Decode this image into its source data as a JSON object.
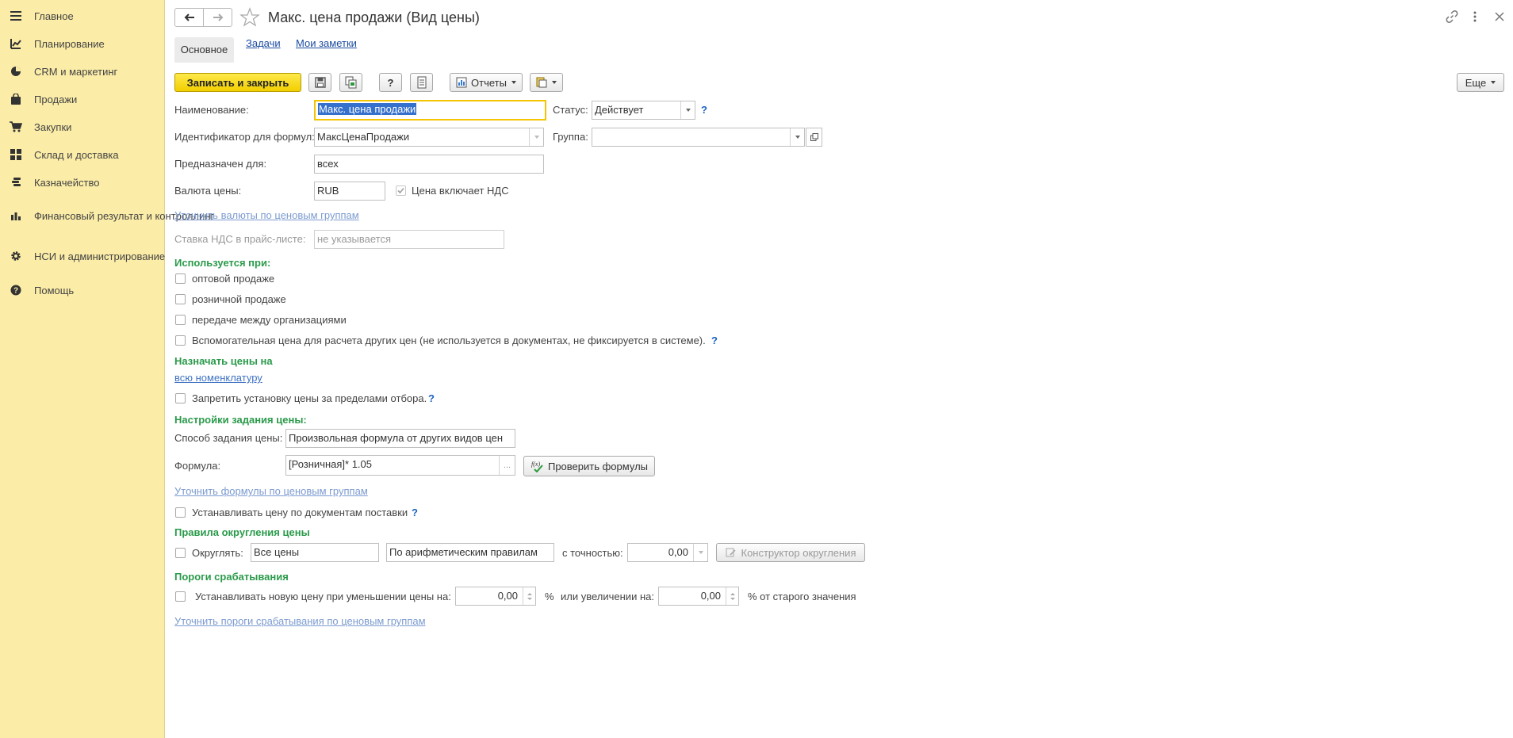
{
  "sidebar": {
    "items": [
      {
        "label": "Главное",
        "icon": "menu-icon"
      },
      {
        "label": "Планирование",
        "icon": "planning-icon"
      },
      {
        "label": "CRM и маркетинг",
        "icon": "pie-chart-icon"
      },
      {
        "label": "Продажи",
        "icon": "shopping-bag-icon"
      },
      {
        "label": "Закупки",
        "icon": "cart-icon"
      },
      {
        "label": "Склад и доставка",
        "icon": "warehouse-icon"
      },
      {
        "label": "Казначейство",
        "icon": "coins-icon"
      },
      {
        "label": "Финансовый результат и контроллинг",
        "icon": "bar-chart-icon"
      },
      {
        "label": "НСИ и администрирование",
        "icon": "gear-icon"
      },
      {
        "label": "Помощь",
        "icon": "help-icon"
      }
    ]
  },
  "header": {
    "title": "Макс. цена продажи (Вид цены)"
  },
  "tabs": [
    {
      "label": "Основное"
    },
    {
      "label": "Задачи"
    },
    {
      "label": "Мои заметки"
    }
  ],
  "toolbar": {
    "save_close": "Записать и закрыть",
    "help": "?",
    "reports": "Отчеты",
    "more": "Еще"
  },
  "form": {
    "name_label": "Наименование:",
    "name_value": "Макс. цена продажи",
    "status_label": "Статус:",
    "status_value": "Действует",
    "formula_id_label": "Идентификатор для формул:",
    "formula_id_value": "МаксЦенаПродажи",
    "group_label": "Группа:",
    "group_value": "",
    "intended_label": "Предназначен для:",
    "intended_value": "всех",
    "currency_label": "Валюта цены:",
    "currency_value": "RUB",
    "vat_included_label": "Цена включает НДС",
    "currency_groups_link": "Уточнить валюты по ценовым группам",
    "vat_rate_label": "Ставка НДС в прайс-листе:",
    "vat_rate_value": "не указывается",
    "used_in_title": "Используется при:",
    "used_in": {
      "wholesale": "оптовой продаже",
      "retail": "розничной продаже",
      "interorg": "передаче между организациями",
      "aux": "Вспомогательная цена для расчета других цен (не используется в документах, не фиксируется в системе)."
    },
    "assign_title": "Назначать цены на",
    "assign_link": "всю номенклатуру",
    "forbid_label": "Запретить установку цены за пределами отбора.",
    "settings_title": "Настройки задания цены:",
    "method_label": "Способ задания цены:",
    "method_value": "Произвольная формула от других видов цен",
    "formula_label": "Формула:",
    "formula_value": "[Розничная]* 1.05",
    "ellipsis": "...",
    "check_formulas": "Проверить формулы",
    "formula_groups_link": "Уточнить формулы по ценовым группам",
    "by_supply_label": "Устанавливать цену по документам поставки",
    "rounding_title": "Правила округления цены",
    "round_label": "Округлять:",
    "round_scope": "Все цены",
    "round_method": "По арифметическим правилам",
    "precision_label": "с точностью:",
    "precision_value": "0,00",
    "round_constructor": "Конструктор округления",
    "thresholds_title": "Пороги срабатывания",
    "threshold_label": "Устанавливать новую цену при уменьшении цены на:",
    "decrease_value": "0,00",
    "percent": "%",
    "increase_label": "или увеличении на:",
    "increase_value": "0,00",
    "from_old_label": "% от старого значения",
    "threshold_groups_link": "Уточнить пороги срабатывания по ценовым группам",
    "q": "?"
  }
}
